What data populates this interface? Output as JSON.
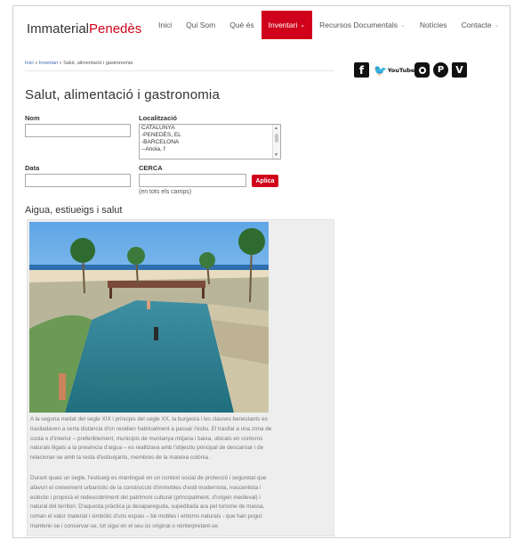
{
  "header": {
    "logo_part1": "Immaterial",
    "logo_part2": "Penedès",
    "nav": [
      {
        "label": "Inici"
      },
      {
        "label": "Qui Som"
      },
      {
        "label": "Què és"
      },
      {
        "label": "Inventari"
      },
      {
        "label": "Recursos Documentals"
      },
      {
        "label": "Notícies"
      },
      {
        "label": "Contacte"
      }
    ],
    "accent_color": "#d0021b"
  },
  "breadcrumb": {
    "home": "Inici",
    "sep1": " » ",
    "section": "Inventari",
    "sep2": " » ",
    "current": "Salut, alimentació i gastronomia"
  },
  "social": {
    "facebook": "f",
    "twitter": "🐦",
    "youtube": "YouTube",
    "pinterest": "P",
    "vimeo": "V"
  },
  "page": {
    "title": "Salut, alimentació i gastronomia"
  },
  "filters": {
    "nom_label": "Nom",
    "nom_value": "",
    "localitzacio_label": "Localització",
    "localitzacio_options": [
      "CATALUNYA",
      "-PENEDÈS, EL",
      "-BARCELONA",
      "--Anoia, l'"
    ],
    "data_label": "Data",
    "data_value": "",
    "cerca_label": "CERCA",
    "cerca_value": "",
    "apply_label": "Aplica",
    "hint": "(en tots els camps)"
  },
  "article": {
    "title": "Aigua, estiueigs i salut",
    "paragraphs": [
      [
        "A la segona meitat del segle XIX i principis del segle XX, la burgesia i les classes benestants es",
        "traslladaven a certa distància d'on residien habitualment a passar l'estiu. El trasllat a una zona de",
        "costa o d'interior – preferiblement, municipis de muntanya mitjana i baixa, ubicats en contorns",
        "naturals lligats a la presència d'aigua – es realitzava amb l'objectiu principal de descansar i de",
        "relacionar-se amb la resta d'estiuejants, membres de la mateixa colònia ."
      ],
      [
        "Durant quasi un segle, l'estiueig es mantingué en un context social de protecció i seguretat que",
        "afavorí el creixement urbanístic de la construcció d'immobles d'estil modernista, noucentista i",
        "eclèctic i propicià el redescobriment del patrimoni cultural (principalment, d'origen medieval) i",
        "natural del territori. D'aquesta pràctica ja desapareguda, supeditada ara pel turisme de massa,",
        "roman el valor material i simbòlic d'uns espais – bé mobles i entorns naturals - que han pogut",
        "mantenir-se i conservar-se, tot sigui en el seu ús original o reinterpretant-se."
      ]
    ]
  }
}
